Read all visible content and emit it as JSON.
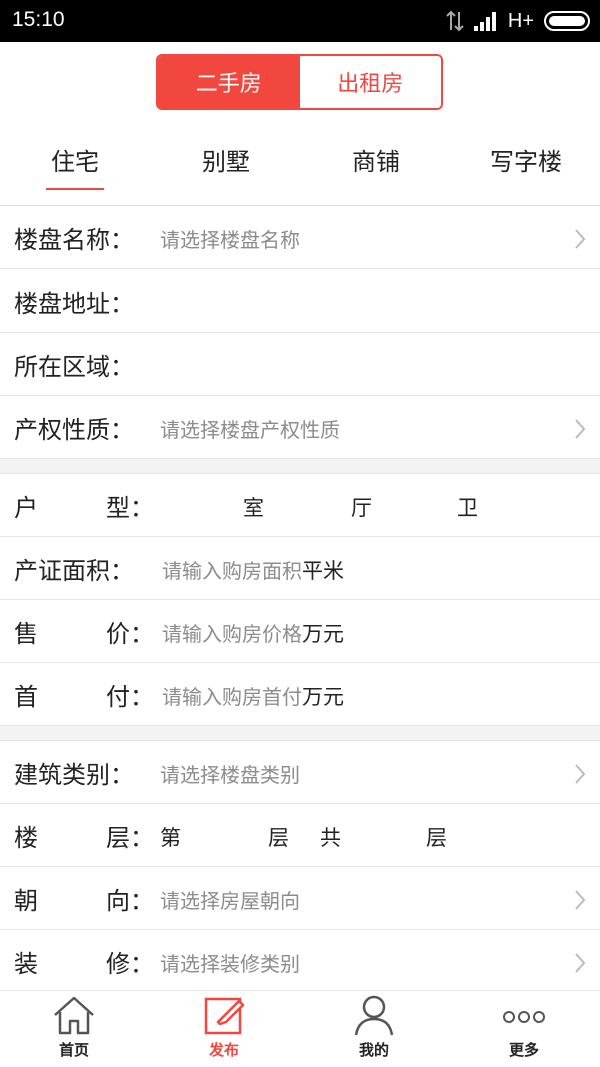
{
  "status_bar": {
    "time": "15:10",
    "network": "H+"
  },
  "listing_type": {
    "options": [
      {
        "label": "二手房",
        "active": true
      },
      {
        "label": "出租房",
        "active": false
      }
    ]
  },
  "property_categories": [
    "住宅",
    "别墅",
    "商铺",
    "写字楼"
  ],
  "selected_category": "住宅",
  "form": {
    "estate_name": {
      "label": "楼盘名称：",
      "placeholder": "请选择楼盘名称"
    },
    "estate_address": {
      "label": "楼盘地址："
    },
    "district": {
      "label": "所在区域："
    },
    "property_right": {
      "label": "产权性质：",
      "placeholder": "请选择楼盘产权性质"
    },
    "layout": {
      "label_a": "户",
      "label_b": "型：",
      "room": "室",
      "hall": "厅",
      "bath": "卫"
    },
    "area": {
      "label": "产证面积：",
      "placeholder": "请输入购房面积",
      "unit": "平米"
    },
    "price": {
      "label_a": "售",
      "label_b": "价：",
      "placeholder": "请输入购房价格",
      "unit": "万元"
    },
    "down_payment": {
      "label_a": "首",
      "label_b": "付：",
      "placeholder": "请输入购房首付",
      "unit": "万元"
    },
    "building_type": {
      "label": "建筑类别：",
      "placeholder": "请选择楼盘类别"
    },
    "floor": {
      "label_a": "楼",
      "label_b": "层：",
      "prefix": "第",
      "mid": "层",
      "total": "共",
      "suffix": "层"
    },
    "orientation": {
      "label_a": "朝",
      "label_b": "向：",
      "placeholder": "请选择房屋朝向"
    },
    "decoration": {
      "label_a": "装",
      "label_b": "修：",
      "placeholder": "请选择装修类别"
    }
  },
  "bottom_nav": [
    {
      "label": "首页",
      "icon": "home-icon",
      "active": false
    },
    {
      "label": "发布",
      "icon": "edit-icon",
      "active": true
    },
    {
      "label": "我的",
      "icon": "user-icon",
      "active": false
    },
    {
      "label": "更多",
      "icon": "more-icon",
      "active": false
    }
  ],
  "colors": {
    "accent": "#f2473f",
    "text": "#222222",
    "placeholder": "#8c8c8c"
  }
}
